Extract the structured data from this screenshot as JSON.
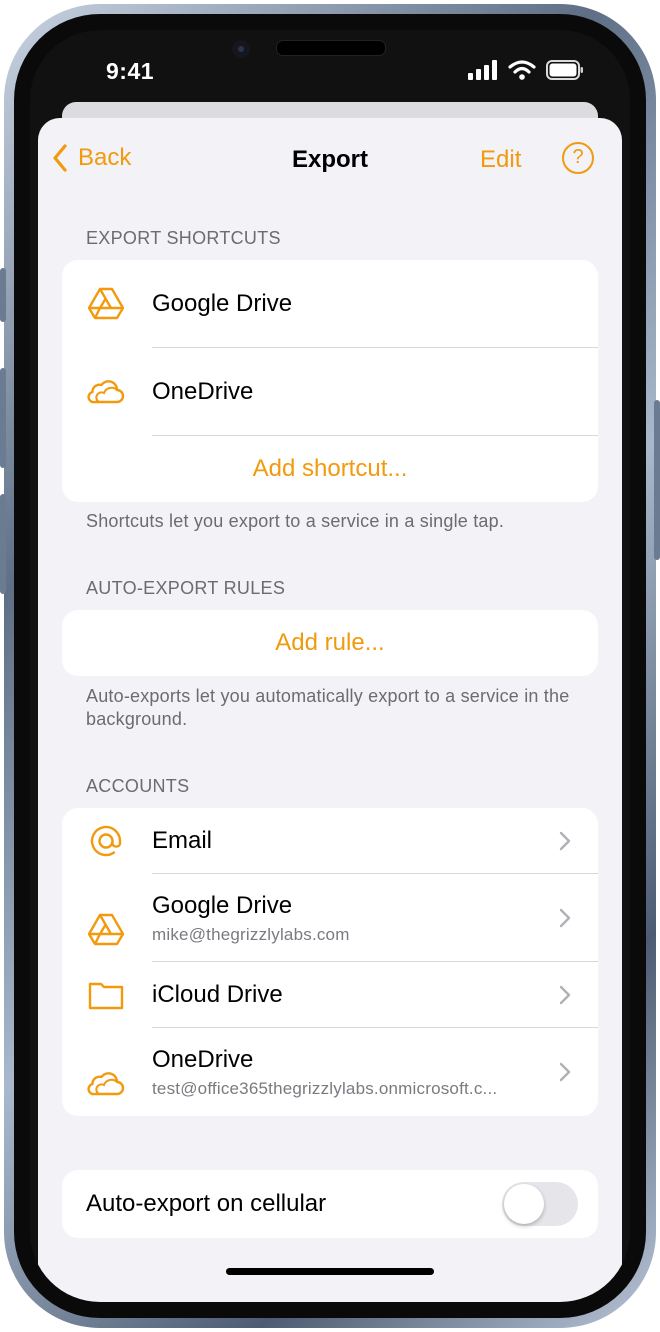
{
  "status_bar": {
    "time": "9:41"
  },
  "nav": {
    "back_label": "Back",
    "title": "Export",
    "edit_label": "Edit",
    "help_symbol": "?"
  },
  "export_shortcuts": {
    "header": "EXPORT SHORTCUTS",
    "items": [
      {
        "label": "Google Drive",
        "icon": "google-drive-icon"
      },
      {
        "label": "OneDrive",
        "icon": "onedrive-cloud-icon"
      }
    ],
    "add_label": "Add shortcut...",
    "footer": "Shortcuts let you export to a service in a single tap."
  },
  "auto_export_rules": {
    "header": "AUTO-EXPORT RULES",
    "add_label": "Add rule...",
    "footer": "Auto-exports let you automatically export to a service in the background."
  },
  "accounts": {
    "header": "ACCOUNTS",
    "items": [
      {
        "label": "Email",
        "subtitle": "",
        "icon": "at-sign-icon"
      },
      {
        "label": "Google Drive",
        "subtitle": "mike@thegrizzlylabs.com",
        "icon": "google-drive-icon"
      },
      {
        "label": "iCloud Drive",
        "subtitle": "",
        "icon": "folder-icon"
      },
      {
        "label": "OneDrive",
        "subtitle": "test@office365thegrizzlylabs.onmicrosoft.c...",
        "icon": "onedrive-cloud-icon"
      }
    ]
  },
  "settings": {
    "auto_export_cellular_label": "Auto-export on cellular",
    "auto_export_cellular_on": false
  },
  "colors": {
    "accent": "#f19a0e",
    "background": "#f2f2f7",
    "card": "#ffffff",
    "secondary_text": "#6c6c70"
  }
}
